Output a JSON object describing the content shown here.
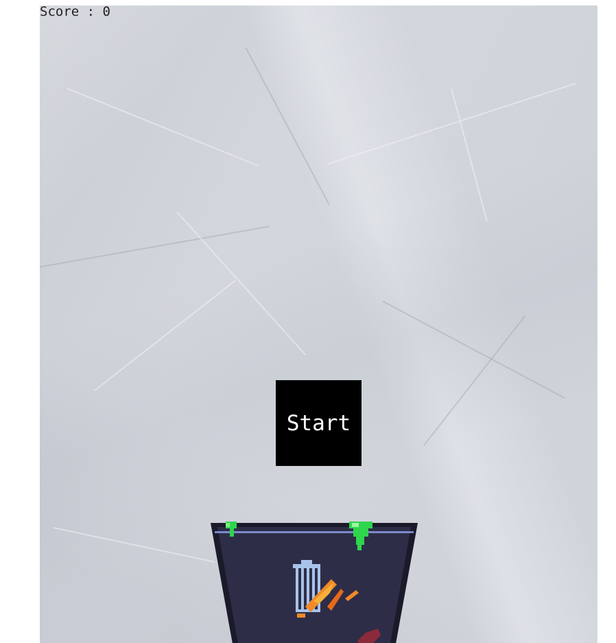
{
  "hud": {
    "score_label": "Score : 0"
  },
  "menu": {
    "start_label": "Start"
  },
  "icons": {
    "bin": "trash-bin-sprite",
    "can": "trash-can-icon",
    "slime": "green-slime",
    "fire": "orange-flame-stains"
  },
  "colors": {
    "bin_body": "#2e2d47",
    "bin_rim": "#1a1a2a",
    "rim_line": "#7d8ac9",
    "slime": "#2ed54d",
    "can_icon": "#a8c3ea",
    "stain_orange": "#f08a2a",
    "stain_red": "#8b2a3a",
    "paper": "#d3d6dc"
  }
}
